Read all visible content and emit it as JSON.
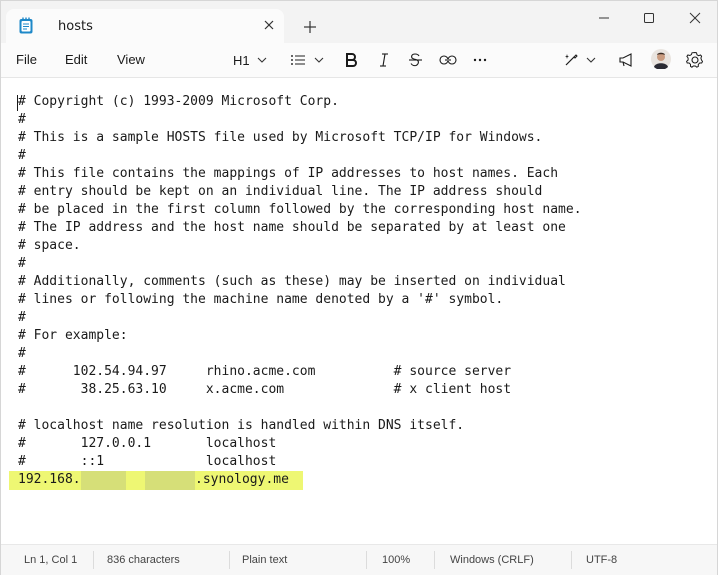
{
  "tab": {
    "title": "hosts"
  },
  "menu": {
    "file": "File",
    "edit": "Edit",
    "view": "View"
  },
  "toolbar": {
    "heading_label": "H1"
  },
  "content": {
    "lines": [
      "# Copyright (c) 1993-2009 Microsoft Corp.",
      "#",
      "# This is a sample HOSTS file used by Microsoft TCP/IP for Windows.",
      "#",
      "# This file contains the mappings of IP addresses to host names. Each",
      "# entry should be kept on an individual line. The IP address should",
      "# be placed in the first column followed by the corresponding host name.",
      "# The IP address and the host name should be separated by at least one",
      "# space.",
      "#",
      "# Additionally, comments (such as these) may be inserted on individual",
      "# lines or following the machine name denoted by a '#' symbol.",
      "#",
      "# For example:",
      "#",
      "#      102.54.94.97     rhino.acme.com          # source server",
      "#       38.25.63.10     x.acme.com              # x client host",
      "",
      "# localhost name resolution is handled within DNS itself.",
      "#       127.0.0.1       localhost",
      "#       ::1             localhost"
    ],
    "last_line_prefix": "192.168.",
    "last_line_suffix": ".synology.me",
    "highlight_color": "#eef773"
  },
  "status": {
    "position": "Ln 1, Col 1",
    "characters": "836 characters",
    "format": "Plain text",
    "zoom": "100%",
    "line_ending": "Windows (CRLF)",
    "encoding": "UTF-8"
  }
}
